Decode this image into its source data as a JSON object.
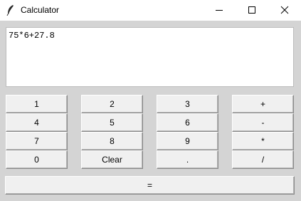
{
  "window": {
    "title": "Calculator",
    "icon": "feather-icon"
  },
  "display": {
    "value": "75*6+27.8"
  },
  "keys": {
    "k1": "1",
    "k2": "2",
    "k3": "3",
    "plus": "+",
    "k4": "4",
    "k5": "5",
    "k6": "6",
    "minus": "-",
    "k7": "7",
    "k8": "8",
    "k9": "9",
    "multiply": "*",
    "k0": "0",
    "clear": "Clear",
    "dot": ".",
    "divide": "/",
    "equals": "="
  }
}
